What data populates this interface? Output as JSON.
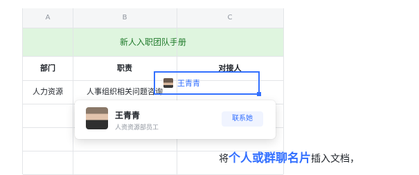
{
  "columns": [
    "A",
    "B",
    "C"
  ],
  "banner": "新人入职团队手册",
  "headers": [
    "部门",
    "职责",
    "对接人"
  ],
  "row1": {
    "dept": "人力资源",
    "duty": "人事组织相关问题咨询",
    "contact": "王青青"
  },
  "popup": {
    "name": "王青青",
    "role": "人资资源部员工",
    "button": "联系她"
  },
  "caption": {
    "pre": "将",
    "highlight": "个人或群聊名片",
    "post": "插入文档，"
  },
  "colors": {
    "accent": "#3370ff",
    "banner_bg": "#dff5df",
    "banner_text": "#1f7a2a"
  }
}
